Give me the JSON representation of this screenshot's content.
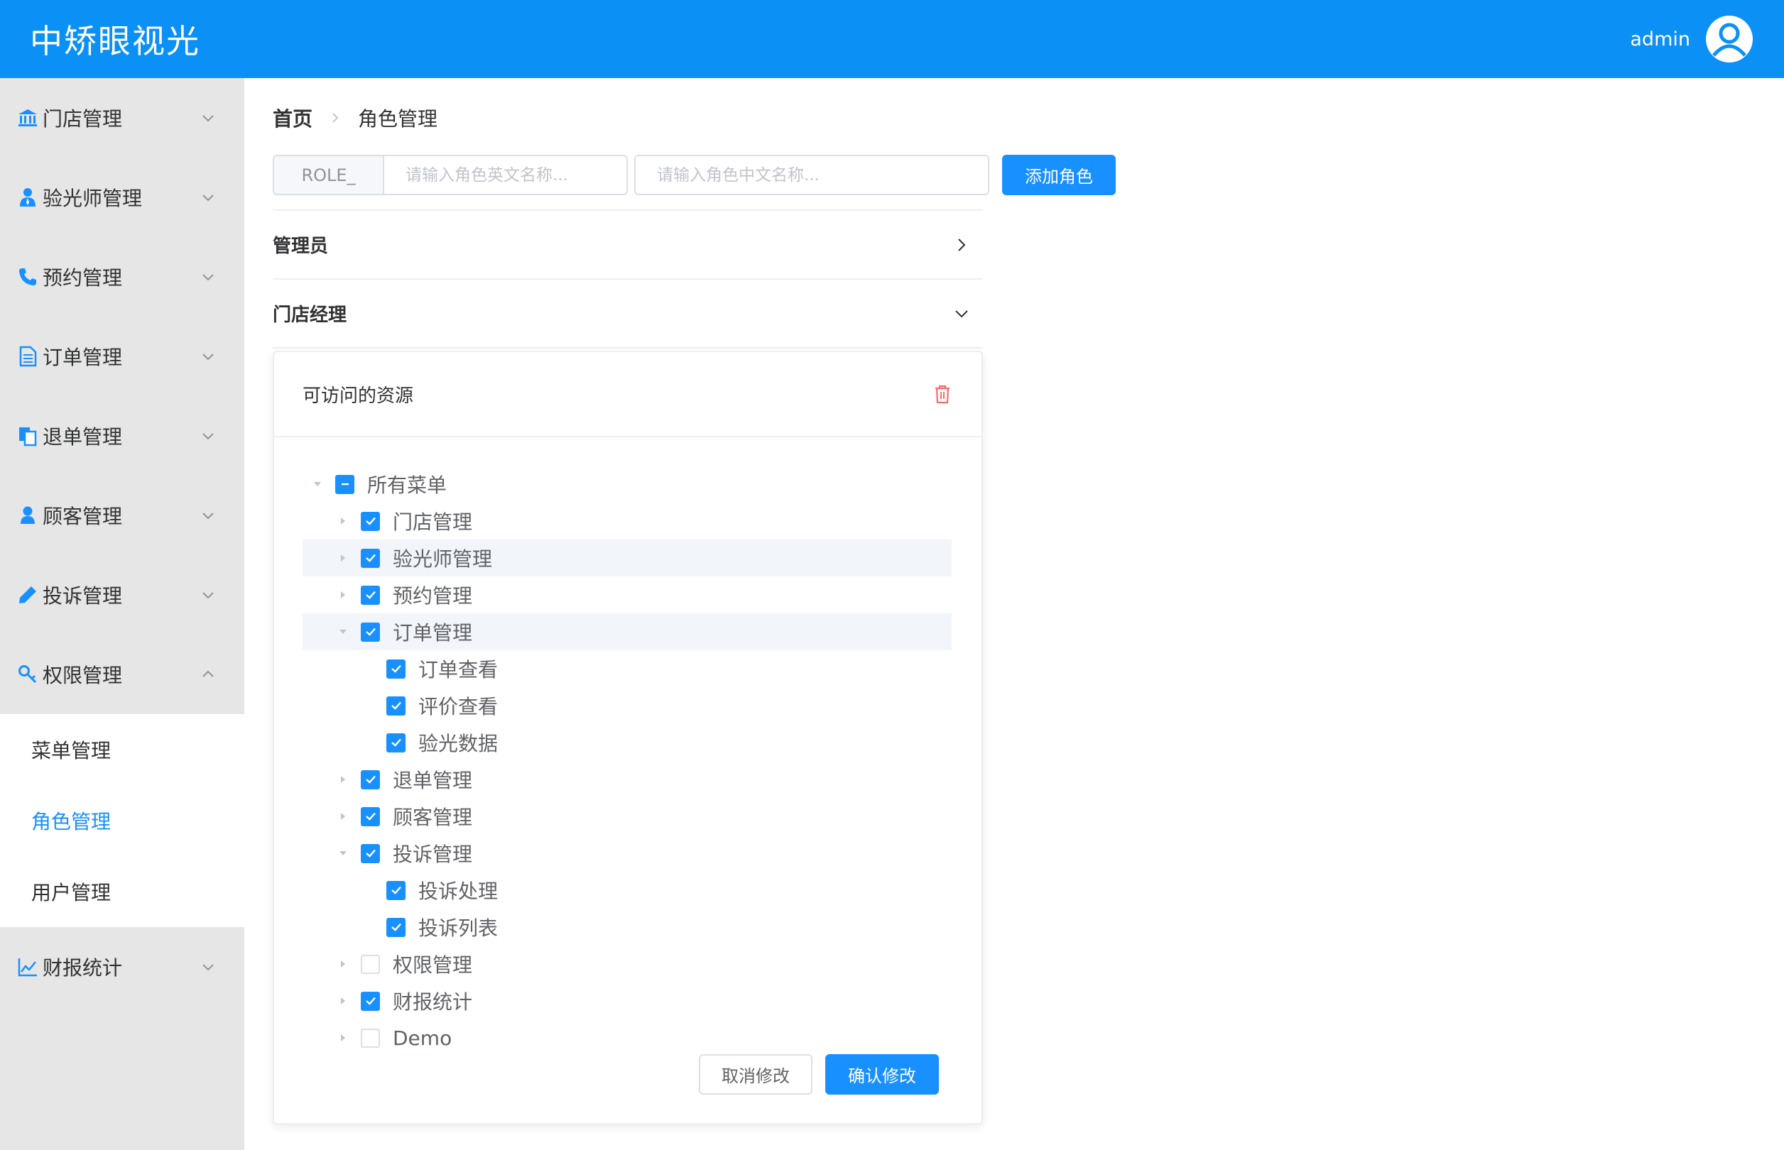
{
  "header": {
    "title": "中矫眼视光",
    "username": "admin",
    "avatar_icon": "user-circle-icon"
  },
  "sidebar": {
    "items": [
      {
        "label": "门店管理",
        "icon": "bank-icon"
      },
      {
        "label": "验光师管理",
        "icon": "person-tie-icon"
      },
      {
        "label": "预约管理",
        "icon": "phone-icon"
      },
      {
        "label": "订单管理",
        "icon": "document-icon"
      },
      {
        "label": "退单管理",
        "icon": "copy-doc-icon"
      },
      {
        "label": "顾客管理",
        "icon": "user-icon"
      },
      {
        "label": "投诉管理",
        "icon": "pencil-icon"
      },
      {
        "label": "权限管理",
        "icon": "key-icon",
        "expanded": true,
        "children": [
          {
            "label": "菜单管理"
          },
          {
            "label": "角色管理",
            "active": true
          },
          {
            "label": "用户管理"
          }
        ]
      },
      {
        "label": "财报统计",
        "icon": "line-chart-icon"
      }
    ]
  },
  "breadcrumb": {
    "home": "首页",
    "current": "角色管理"
  },
  "toolbar": {
    "prefix": "ROLE_",
    "en_placeholder": "请输入角色英文名称...",
    "cn_placeholder": "请输入角色中文名称...",
    "add_label": "添加角色"
  },
  "roles": [
    {
      "name": "管理员",
      "expanded": false
    },
    {
      "name": "门店经理",
      "expanded": true
    }
  ],
  "resources": {
    "title": "可访问的资源",
    "tree": [
      {
        "label": "所有菜单",
        "level": 0,
        "state": "indeterminate",
        "caret": "open"
      },
      {
        "label": "门店管理",
        "level": 1,
        "state": "checked",
        "caret": "closed"
      },
      {
        "label": "验光师管理",
        "level": 1,
        "state": "checked",
        "caret": "closed",
        "highlight": true
      },
      {
        "label": "预约管理",
        "level": 1,
        "state": "checked",
        "caret": "closed"
      },
      {
        "label": "订单管理",
        "level": 1,
        "state": "checked",
        "caret": "open",
        "highlight": true
      },
      {
        "label": "订单查看",
        "level": 2,
        "state": "checked",
        "caret": "none"
      },
      {
        "label": "评价查看",
        "level": 2,
        "state": "checked",
        "caret": "none"
      },
      {
        "label": "验光数据",
        "level": 2,
        "state": "checked",
        "caret": "none"
      },
      {
        "label": "退单管理",
        "level": 1,
        "state": "checked",
        "caret": "closed"
      },
      {
        "label": "顾客管理",
        "level": 1,
        "state": "checked",
        "caret": "closed"
      },
      {
        "label": "投诉管理",
        "level": 1,
        "state": "checked",
        "caret": "open"
      },
      {
        "label": "投诉处理",
        "level": 2,
        "state": "checked",
        "caret": "none"
      },
      {
        "label": "投诉列表",
        "level": 2,
        "state": "checked",
        "caret": "none"
      },
      {
        "label": "权限管理",
        "level": 1,
        "state": "unchecked",
        "caret": "closed"
      },
      {
        "label": "财报统计",
        "level": 1,
        "state": "checked",
        "caret": "closed"
      },
      {
        "label": "Demo",
        "level": 1,
        "state": "unchecked",
        "caret": "closed"
      }
    ],
    "cancel_label": "取消修改",
    "confirm_label": "确认修改"
  },
  "colors": {
    "primary": "#1890ff",
    "header": "#0b90f5",
    "sidebar": "#e6e6e6",
    "danger": "#f56c6c"
  }
}
